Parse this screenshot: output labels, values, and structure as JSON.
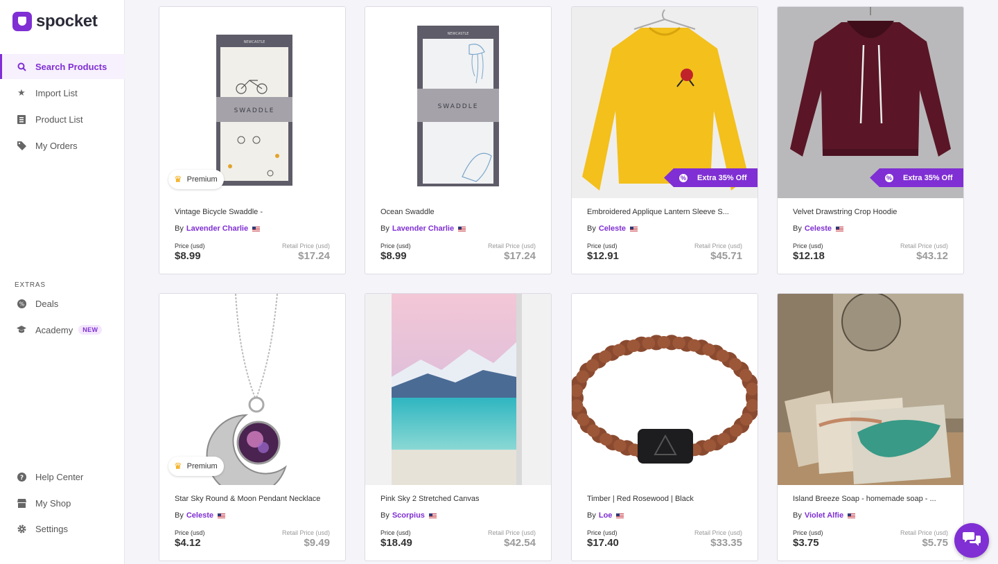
{
  "brand": {
    "name": "spocket",
    "accent": "#7f2fd3"
  },
  "sidebar": {
    "items": [
      {
        "label": "Search Products",
        "icon": "search-icon",
        "active": true
      },
      {
        "label": "Import List",
        "icon": "star-icon"
      },
      {
        "label": "Product List",
        "icon": "list-icon"
      },
      {
        "label": "My Orders",
        "icon": "tag-icon"
      }
    ],
    "extras_label": "EXTRAS",
    "extras": [
      {
        "label": "Deals",
        "icon": "percent-icon"
      },
      {
        "label": "Academy",
        "icon": "graduation-cap-icon",
        "badge": "NEW"
      }
    ],
    "bottom": [
      {
        "label": "Help Center",
        "icon": "help-icon"
      },
      {
        "label": "My Shop",
        "icon": "shop-icon"
      },
      {
        "label": "Settings",
        "icon": "gear-icon"
      }
    ]
  },
  "labels": {
    "by": "By",
    "price": "Price (usd)",
    "retail": "Retail Price (usd)",
    "premium": "Premium",
    "deal": "Extra 35% Off"
  },
  "products": [
    {
      "title": "Vintage Bicycle Swaddle -",
      "seller": "Lavender Charlie",
      "price": "$8.99",
      "retail": "$17.24",
      "premium": true,
      "image": "swaddle-bicycle-image"
    },
    {
      "title": "Ocean Swaddle",
      "seller": "Lavender Charlie",
      "price": "$8.99",
      "retail": "$17.24",
      "image": "swaddle-ocean-image"
    },
    {
      "title": "Embroidered Applique Lantern Sleeve S...",
      "seller": "Celeste",
      "price": "$12.91",
      "retail": "$45.71",
      "deal": true,
      "image": "yellow-sweater-image"
    },
    {
      "title": "Velvet Drawstring Crop Hoodie",
      "seller": "Celeste",
      "price": "$12.18",
      "retail": "$43.12",
      "deal": true,
      "image": "burgundy-hoodie-image"
    },
    {
      "title": "Star Sky Round & Moon Pendant Necklace",
      "seller": "Celeste",
      "price": "$4.12",
      "retail": "$9.49",
      "premium": true,
      "image": "moon-necklace-image"
    },
    {
      "title": "Pink Sky 2 Stretched Canvas",
      "seller": "Scorpius",
      "price": "$18.49",
      "retail": "$42.54",
      "image": "canvas-mountains-image"
    },
    {
      "title": "Timber | Red Rosewood | Black",
      "seller": "Loe",
      "price": "$17.40",
      "retail": "$33.35",
      "image": "bead-bracelet-image"
    },
    {
      "title": "Island Breeze Soap - homemade soap - ...",
      "seller": "Violet Alfie",
      "price": "$3.75",
      "retail": "$5.75",
      "image": "soap-bars-image"
    }
  ],
  "chat": {
    "icon": "chat-icon"
  }
}
